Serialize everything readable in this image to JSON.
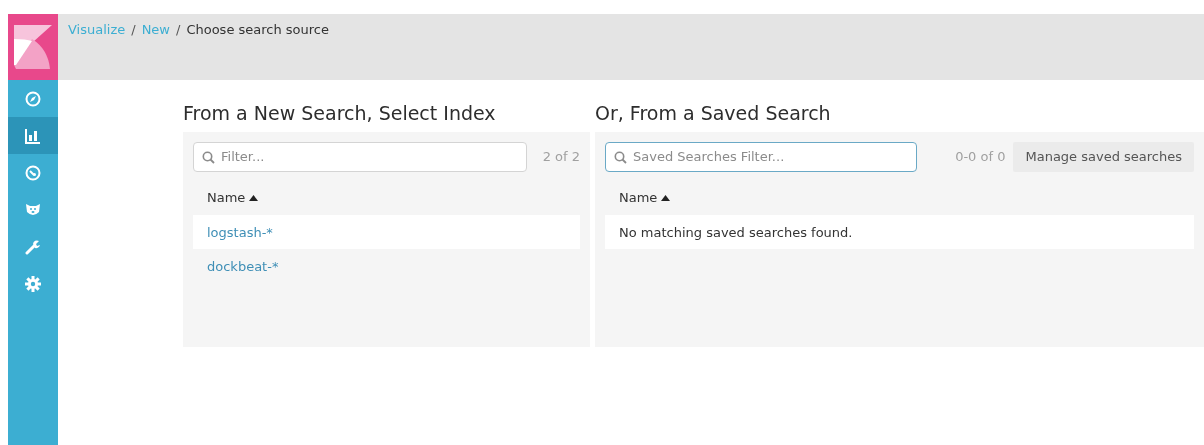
{
  "sidebar": {
    "items": [
      {
        "kind": "compass",
        "selected": false
      },
      {
        "kind": "chart",
        "selected": true
      },
      {
        "kind": "gauge",
        "selected": false
      },
      {
        "kind": "bear",
        "selected": false
      },
      {
        "kind": "wrench",
        "selected": false
      },
      {
        "kind": "gear",
        "selected": false
      }
    ]
  },
  "breadcrumb_separators": [
    "/",
    "/"
  ],
  "breadcrumbs": [
    {
      "label": "Visualize",
      "link": true
    },
    {
      "label": "New",
      "link": true
    },
    {
      "label": "Choose search source",
      "link": false
    }
  ],
  "new_search": {
    "title": "From a New Search, Select Index",
    "filter": {
      "placeholder": "Filter...",
      "focused": false
    },
    "count": "2 of 2",
    "column": "Name",
    "rows": [
      {
        "label": "logstash-*"
      },
      {
        "label": "dockbeat-*"
      }
    ]
  },
  "saved_search": {
    "title": "Or, From a Saved Search",
    "filter": {
      "placeholder": "Saved Searches Filter...",
      "focused": true
    },
    "count": "0-0 of 0",
    "button": "Manage saved searches",
    "column": "Name",
    "message": "No matching saved searches found."
  }
}
